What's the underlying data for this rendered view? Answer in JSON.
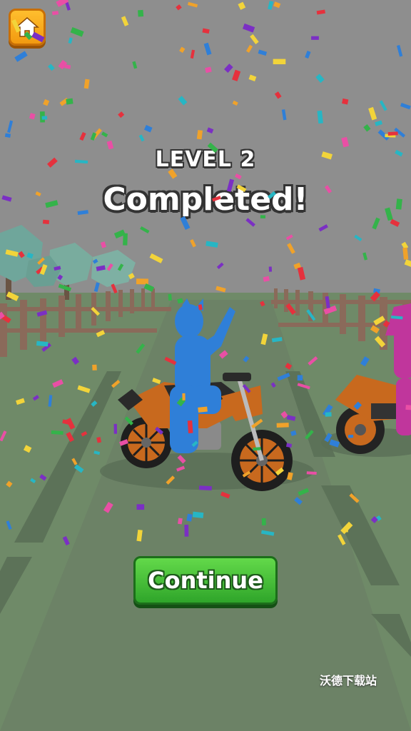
{
  "level_title": "LEVEL 2",
  "completed_text": "Completed!",
  "continue_label": "Continue",
  "watermark": "沃德下载站",
  "icons": {
    "home": "home-icon"
  },
  "colors": {
    "home_button": "#f5a91c",
    "continue_button": "#3dbb35",
    "player_rider": "#2f7fd8",
    "rival_rider": "#c0369c",
    "motorbike": "#c8691e",
    "confetti": [
      "#e5313d",
      "#2f7fd8",
      "#7b2fc4",
      "#f0a22a",
      "#34b34a",
      "#e94fa5",
      "#27b6c4",
      "#f2d43a"
    ]
  }
}
